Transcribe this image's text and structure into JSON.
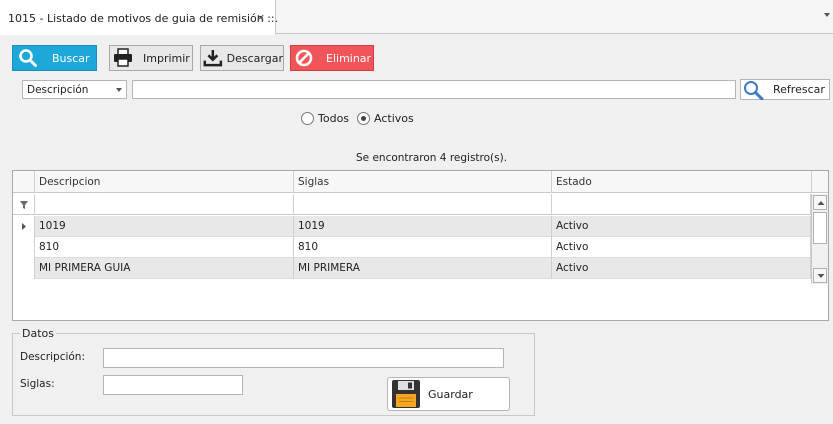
{
  "tab": {
    "title": "1015 - Listado de motivos de guia de remisión ::.",
    "close": "×"
  },
  "toolbar": {
    "buscar": "Buscar",
    "imprimir": "Imprimir",
    "descargar": "Descargar",
    "eliminar": "Eliminar"
  },
  "filter": {
    "field_selected": "Descripción",
    "search_value": "",
    "refrescar": "Refrescar"
  },
  "radios": {
    "todos": "Todos",
    "activos": "Activos",
    "selected": "activos"
  },
  "result_text": "Se encontraron 4 registro(s).",
  "grid": {
    "columns": [
      "Descripcion",
      "Siglas",
      "Estado"
    ],
    "rows": [
      {
        "descripcion": "1019",
        "siglas": "1019",
        "estado": "Activo"
      },
      {
        "descripcion": "810",
        "siglas": "810",
        "estado": "Activo"
      },
      {
        "descripcion": "MI PRIMERA GUIA",
        "siglas": "MI PRIMERA",
        "estado": "Activo"
      }
    ]
  },
  "datos": {
    "title": "Datos",
    "descripcion_label": "Descripción:",
    "descripcion_value": "",
    "siglas_label": "Siglas:",
    "siglas_value": "",
    "guardar": "Guardar"
  },
  "colors": {
    "buscar": "#1ea7d9",
    "eliminar": "#f0555a"
  }
}
